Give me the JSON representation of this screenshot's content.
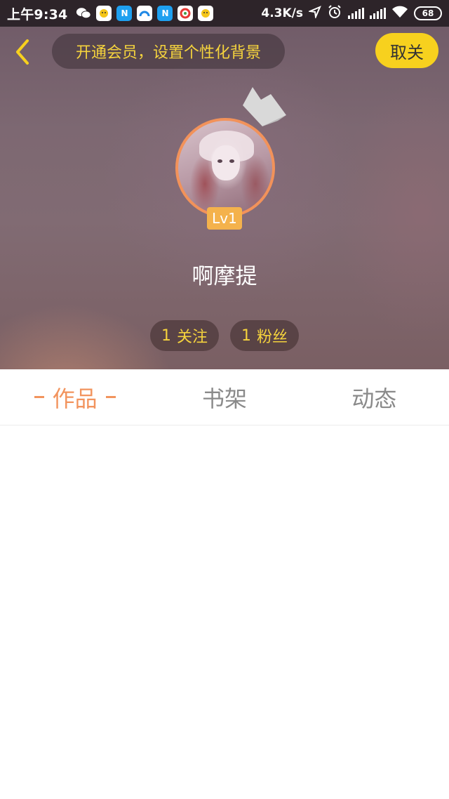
{
  "status_bar": {
    "time": "上午9:34",
    "net_speed": "4.3K/s",
    "battery": "68",
    "app_icons": [
      "wechat-icon",
      "qq-icon",
      "n-app-icon",
      "browser-icon",
      "n-app-icon",
      "gallery-icon",
      "qq-icon"
    ]
  },
  "header": {
    "back_icon": "chevron-left-icon",
    "vip_banner": "开通会员，设置个性化背景",
    "unfollow_label": "取关"
  },
  "profile": {
    "level": "Lv1",
    "username": "啊摩提",
    "follow_count": "1",
    "follow_label": "关注",
    "fans_count": "1",
    "fans_label": "粉丝"
  },
  "tabs": [
    {
      "label": "作品",
      "active": true
    },
    {
      "label": "书架",
      "active": false
    },
    {
      "label": "动态",
      "active": false
    }
  ],
  "colors": {
    "accent": "#f2945e",
    "yellow": "#f7d11e",
    "banner_text": "#f5d33d",
    "level_badge": "#f4b24c"
  }
}
